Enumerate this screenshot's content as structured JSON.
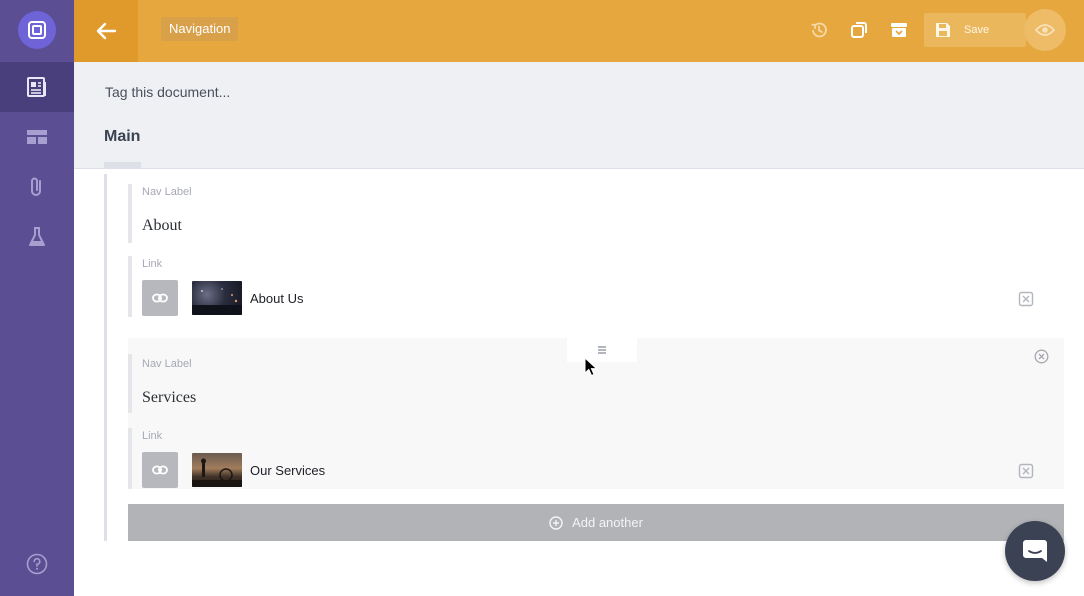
{
  "colors": {
    "sidebar": "#5b4e93",
    "sidebar_active": "#4a3f7d",
    "topbar": "#e6a73f",
    "accent_logo": "#6f63d8",
    "add_button": "#b1b3b7",
    "chat": "#3b4254"
  },
  "sidebar": {
    "items": [
      {
        "icon": "document-icon",
        "active": true
      },
      {
        "icon": "layout-icon",
        "active": false
      },
      {
        "icon": "paperclip-icon",
        "active": false
      },
      {
        "icon": "flask-icon",
        "active": false
      }
    ],
    "help_icon": "help-icon"
  },
  "topbar": {
    "doc_title": "Navigation",
    "actions": [
      "history-icon",
      "duplicate-icon",
      "archive-icon"
    ],
    "save_label": "Save",
    "preview_icon": "eye-icon"
  },
  "document": {
    "tag_placeholder": "Tag this document...",
    "tabs": [
      {
        "label": "Main",
        "active": true
      }
    ]
  },
  "nav_items": [
    {
      "label_field": "Nav Label",
      "label_value": "About",
      "link_field": "Link",
      "link_title": "About Us"
    },
    {
      "label_field": "Nav Label",
      "label_value": "Services",
      "link_field": "Link",
      "link_title": "Our Services"
    }
  ],
  "add_another_label": "Add another",
  "drag_handle_icon": "drag-handle-icon",
  "chat_icon": "chat-icon"
}
